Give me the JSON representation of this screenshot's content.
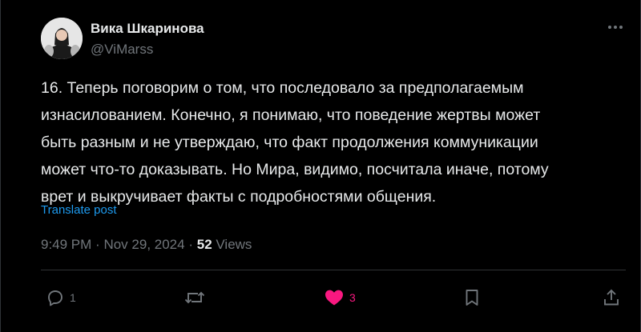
{
  "author": {
    "name": "Вика Шкаринова",
    "handle": "@ViMarss"
  },
  "tweet": {
    "lines": [
      "16. Теперь поговорим о том, что последовало за предполагаемым",
      "изнасилованием. Конечно, я понимаю, что поведение жертвы может",
      "быть разным и не утверждаю, что факт продолжения коммуникации",
      "может что-то доказывать. Но Мира, видимо, посчитала иначе, потому",
      "врет и выкручивает факты с подробностями общения."
    ],
    "translate_label": "Translate post"
  },
  "meta": {
    "time": "9:49 PM",
    "separator": "·",
    "date": "Nov 29, 2024",
    "views_count": "52",
    "views_label": "Views"
  },
  "actions": {
    "reply_count": "1",
    "repost_count": "",
    "like_count": "3"
  },
  "colors": {
    "background": "#000000",
    "text": "#e7e9ea",
    "secondary": "#71767b",
    "link": "#1d9bf0",
    "like": "#f91880",
    "divider": "#2f3336"
  }
}
